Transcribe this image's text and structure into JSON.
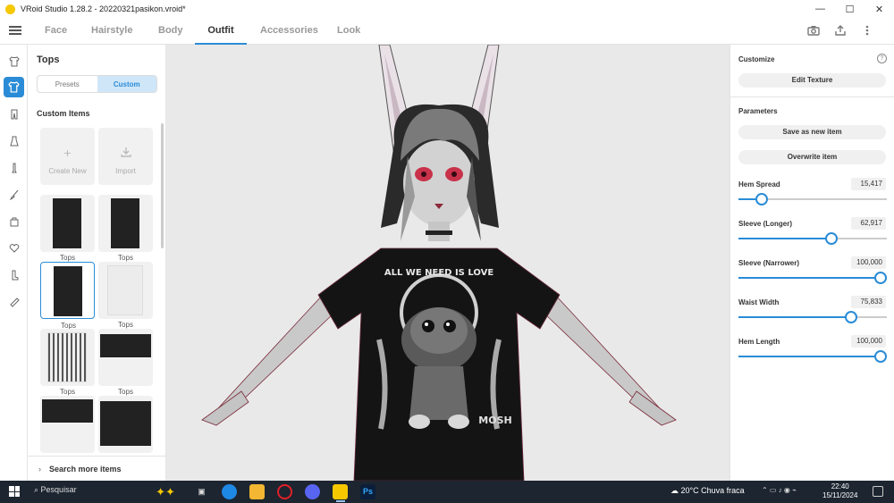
{
  "window": {
    "title": "VRoid Studio 1.28.2 - 20220321pasikon.vroid*",
    "controls": [
      "—",
      "☐",
      "✕"
    ]
  },
  "nav": {
    "tabs": [
      {
        "label": "Face"
      },
      {
        "label": "Hairstyle"
      },
      {
        "label": "Body"
      },
      {
        "label": "Outfit"
      },
      {
        "label": "Accessories"
      },
      {
        "label": "Look"
      }
    ],
    "active_tab": "Outfit"
  },
  "iconbar": [
    "shirt-outline-icon",
    "tops-icon",
    "pants-icon",
    "onepiece-icon",
    "socks-icon",
    "brush-icon",
    "bag-icon",
    "heart-icon",
    "boots-icon",
    "tie-icon"
  ],
  "left_panel": {
    "title": "Tops",
    "presets_label": "Presets",
    "custom_label": "Custom",
    "section_title": "Custom Items",
    "create_new_label": "Create New",
    "import_label": "Import",
    "item_label": "Tops",
    "search_more_label": "Search more items"
  },
  "right_panel": {
    "customize_title": "Customize",
    "edit_texture_label": "Edit Texture",
    "parameters_title": "Parameters",
    "save_new_label": "Save as new item",
    "overwrite_label": "Overwrite item",
    "params": [
      {
        "label": "Hem Spread",
        "value": "15,417",
        "fraction": 0.154
      },
      {
        "label": "Sleeve (Longer)",
        "value": "62,917",
        "fraction": 0.629
      },
      {
        "label": "Sleeve (Narrower)",
        "value": "100,000",
        "fraction": 1.0
      },
      {
        "label": "Waist Width",
        "value": "75,833",
        "fraction": 0.758
      },
      {
        "label": "Hem Length",
        "value": "100,000",
        "fraction": 1.0
      }
    ]
  },
  "viewport": {
    "shirt_text": "ALL WE NEED IS LOVE",
    "shirt_side_text": "MOSH"
  },
  "taskbar": {
    "search_label": "Pesquisar",
    "weather": "20°C  Chuva fraca",
    "time": "22:40",
    "date": "15/11/2024"
  },
  "colors": {
    "accent": "#2a8cd6",
    "taskbar": "#1c2530"
  }
}
